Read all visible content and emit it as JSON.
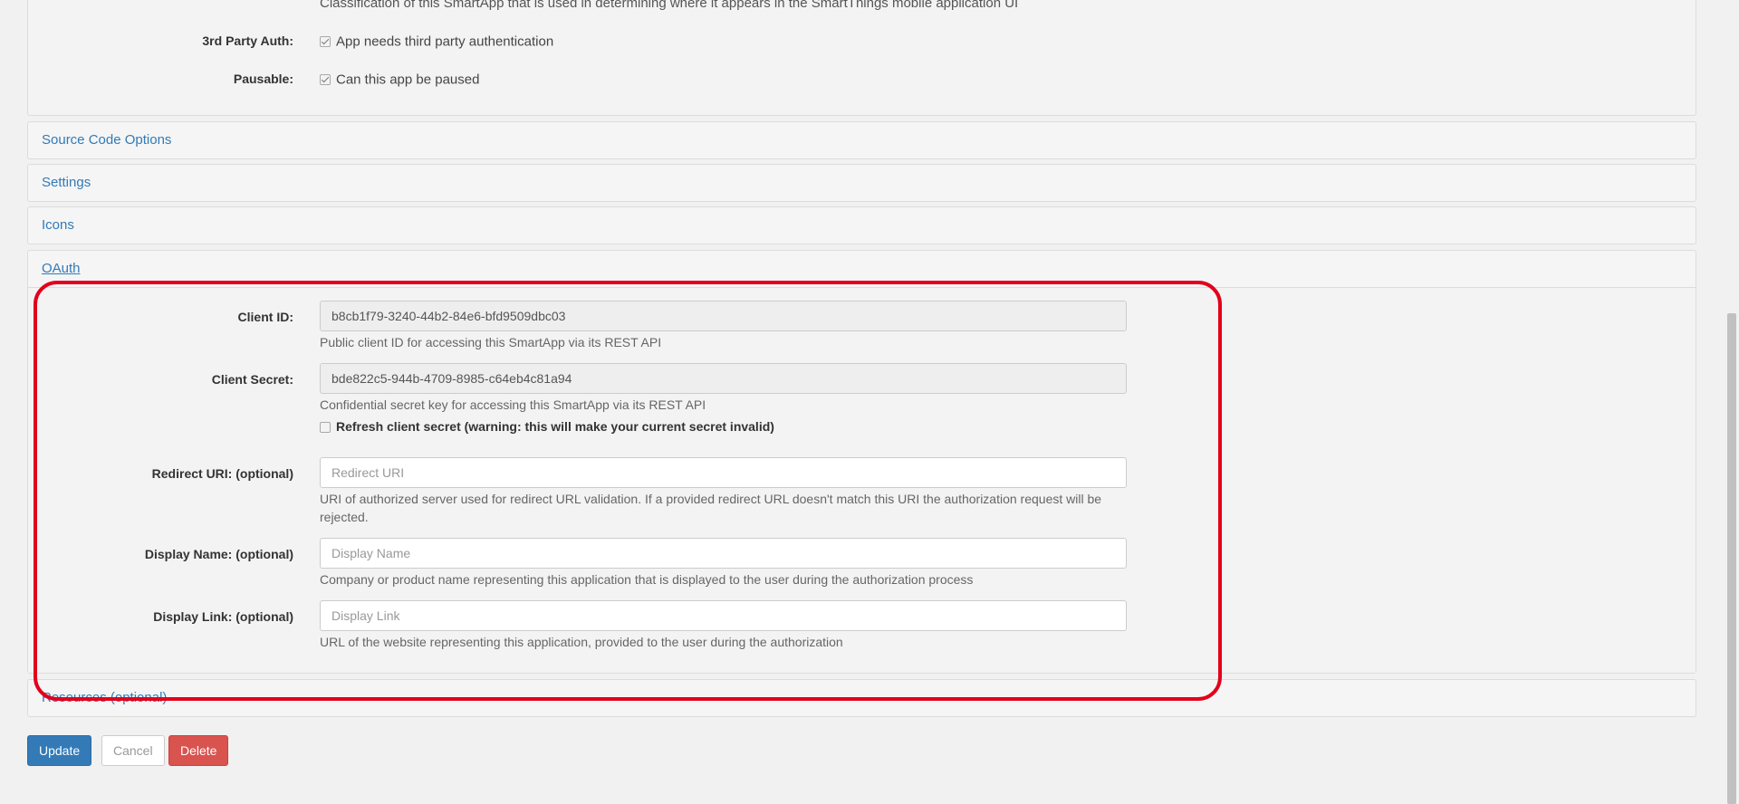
{
  "app_section": {
    "classification_help": "Classification of this SmartApp that is used in determining where it appears in the SmartThings mobile application UI",
    "third_party_auth": {
      "label": "3rd Party Auth:",
      "text": "App needs third party authentication",
      "checked": true
    },
    "pausable": {
      "label": "Pausable:",
      "text": "Can this app be paused",
      "checked": true
    }
  },
  "panels": {
    "source_code": "Source Code Options",
    "settings": "Settings",
    "icons": "Icons",
    "oauth": "OAuth",
    "resources": "Resources (optional)"
  },
  "oauth": {
    "client_id": {
      "label": "Client ID:",
      "value": "b8cb1f79-3240-44b2-84e6-bfd9509dbc03",
      "help": "Public client ID for accessing this SmartApp via its REST API"
    },
    "client_secret": {
      "label": "Client Secret:",
      "value": "bde822c5-944b-4709-8985-c64eb4c81a94",
      "help": "Confidential secret key for accessing this SmartApp via its REST API",
      "refresh_text": "Refresh client secret (warning: this will make your current secret invalid)"
    },
    "redirect_uri": {
      "label": "Redirect URI: (optional)",
      "placeholder": "Redirect URI",
      "value": "",
      "help": "URI of authorized server used for redirect URL validation. If a provided redirect URL doesn't match this URI the authorization request will be rejected."
    },
    "display_name": {
      "label": "Display Name: (optional)",
      "placeholder": "Display Name",
      "value": "",
      "help": "Company or product name representing this application that is displayed to the user during the authorization process"
    },
    "display_link": {
      "label": "Display Link: (optional)",
      "placeholder": "Display Link",
      "value": "",
      "help": "URL of the website representing this application, provided to the user during the authorization"
    }
  },
  "buttons": {
    "update": "Update",
    "cancel": "Cancel",
    "delete": "Delete"
  },
  "colors": {
    "link": "#337ab7",
    "primary": "#337ab7",
    "danger": "#d9534f",
    "highlight": "#e3001b"
  }
}
